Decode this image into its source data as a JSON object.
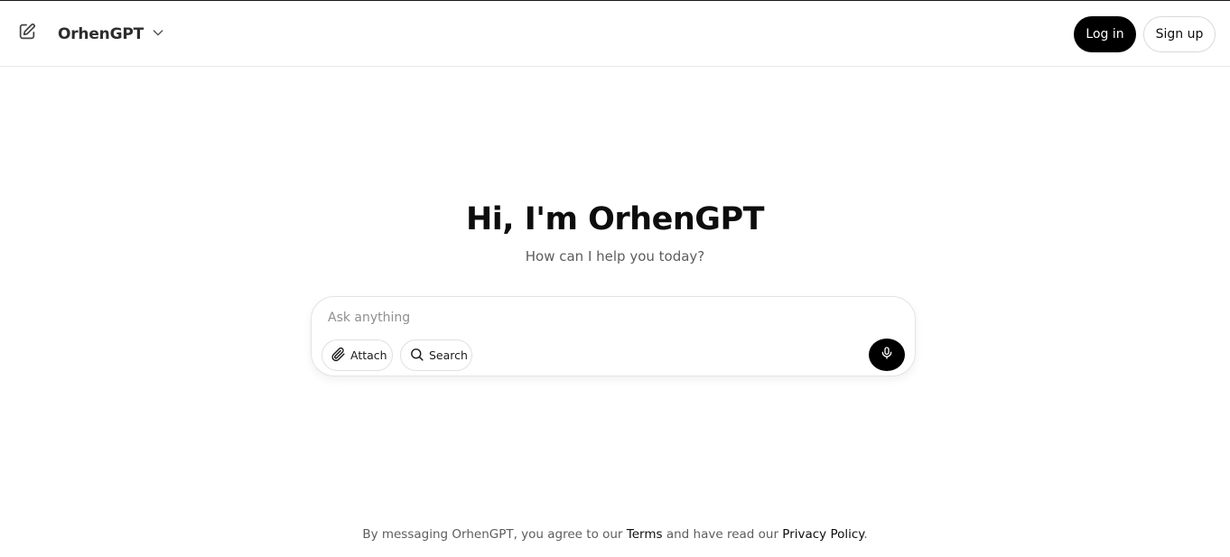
{
  "header": {
    "brand_name": "OrhenGPT",
    "new_chat_icon": "pencil-square-icon",
    "dropdown_icon": "chevron-down-icon",
    "login_label": "Log in",
    "signup_label": "Sign up"
  },
  "hero": {
    "title": "Hi, I'm OrhenGPT",
    "subtitle": "How can I help you today?"
  },
  "composer": {
    "placeholder": "Ask anything",
    "value": "",
    "attach_label": "Attach",
    "attach_icon": "paperclip-icon",
    "search_label": "Search",
    "search_icon": "search-icon",
    "mic_icon": "microphone-icon"
  },
  "footer": {
    "text_before": "By messaging OrhenGPT, you agree to our ",
    "terms_label": "Terms",
    "text_middle": " and have read our ",
    "privacy_label": "Privacy Policy",
    "text_after": "."
  },
  "colors": {
    "primary_button": "#000000",
    "text_muted": "#5d5d5d",
    "border": "#e3e3e3"
  }
}
